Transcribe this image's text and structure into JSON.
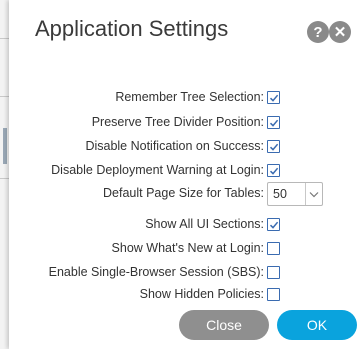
{
  "dialog": {
    "title": "Application Settings",
    "help_icon_glyph": "?",
    "close_icon_glyph": "✕"
  },
  "settings": [
    {
      "label": "Remember Tree Selection:",
      "type": "checkbox",
      "checked": true
    },
    {
      "label": "Preserve Tree Divider Position:",
      "type": "checkbox",
      "checked": true
    },
    {
      "label": "Disable Notification on Success:",
      "type": "checkbox",
      "checked": true
    },
    {
      "label": "Disable Deployment Warning at Login:",
      "type": "checkbox",
      "checked": true
    },
    {
      "label": "Default Page Size for Tables:",
      "type": "select",
      "value": "50"
    },
    {
      "label": "Show All UI Sections:",
      "type": "checkbox",
      "checked": true
    },
    {
      "label": "Show What's New at Login:",
      "type": "checkbox",
      "checked": false
    },
    {
      "label": "Enable Single-Browser Session (SBS):",
      "type": "checkbox",
      "checked": false
    },
    {
      "label": "Show Hidden Policies:",
      "type": "checkbox",
      "checked": false
    }
  ],
  "buttons": {
    "close_label": "Close",
    "ok_label": "OK"
  },
  "colors": {
    "checkbox_border": "#3a6bb0",
    "ok_button": "#0aa3dd",
    "close_button": "#8f8f8f"
  }
}
